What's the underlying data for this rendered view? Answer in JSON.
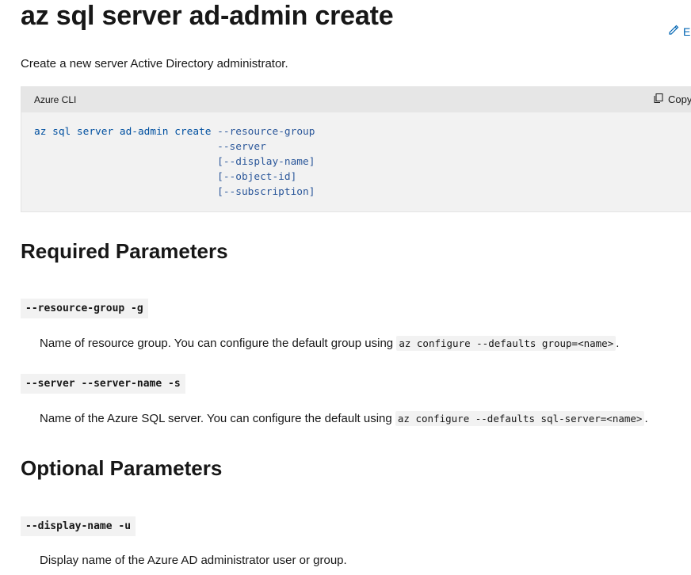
{
  "page": {
    "title": "az sql server ad-admin create",
    "edit_label": "Ec",
    "description": "Create a new server Active Directory administrator."
  },
  "code_block": {
    "language": "Azure CLI",
    "copy_label": "Copy",
    "lines": [
      {
        "command": "az sql server ad-admin create",
        "arg": "--resource-group"
      },
      {
        "command": "",
        "arg": "--server"
      },
      {
        "command": "",
        "arg": "[--display-name]"
      },
      {
        "command": "",
        "arg": "[--object-id]"
      },
      {
        "command": "",
        "arg": "[--subscription]"
      }
    ]
  },
  "required": {
    "heading": "Required Parameters",
    "params": [
      {
        "name": "--resource-group -g",
        "desc_before": "Name of resource group. You can configure the default group using ",
        "code": "az configure --defaults group=<name>",
        "desc_after": "."
      },
      {
        "name": "--server --server-name -s",
        "desc_before": "Name of the Azure SQL server. You can configure the default using ",
        "code": "az configure --defaults sql-server=<name>",
        "desc_after": "."
      }
    ]
  },
  "optional": {
    "heading": "Optional Parameters",
    "params": [
      {
        "name": "--display-name -u",
        "desc_before": "Display name of the Azure AD administrator user or group.",
        "code": "",
        "desc_after": ""
      }
    ]
  },
  "icons": {
    "edit": "pencil-icon",
    "copy": "copy-icon"
  },
  "colors": {
    "link": "#0065b3",
    "code_text": "#2b579a",
    "code_bg": "#f2f2f2"
  }
}
